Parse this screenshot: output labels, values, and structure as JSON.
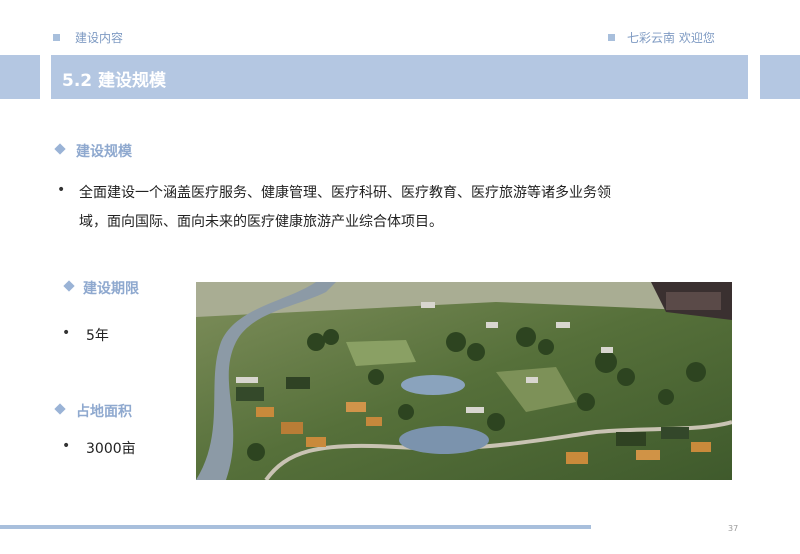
{
  "header": {
    "left_label": "建设内容",
    "right_label": "七彩云南 欢迎您"
  },
  "title": "5.2 建设规模",
  "sections": {
    "scale": {
      "title": "建设规模",
      "line1": "全面建设一个涵盖医疗服务、健康管理、医疗科研、医疗教育、医疗旅游等诸多业务领",
      "line2": "域，面向国际、面向未来的医疗健康旅游产业综合体项目。"
    },
    "period": {
      "title": "建设期限",
      "value": "5年"
    },
    "area": {
      "title": "占地面积",
      "value": "3000亩"
    }
  },
  "bullet_char": "•",
  "page_number": "37",
  "colors": {
    "accent": "#b4c7e2",
    "section_title": "#8fa9cf",
    "header_text": "#7f9bc3"
  }
}
